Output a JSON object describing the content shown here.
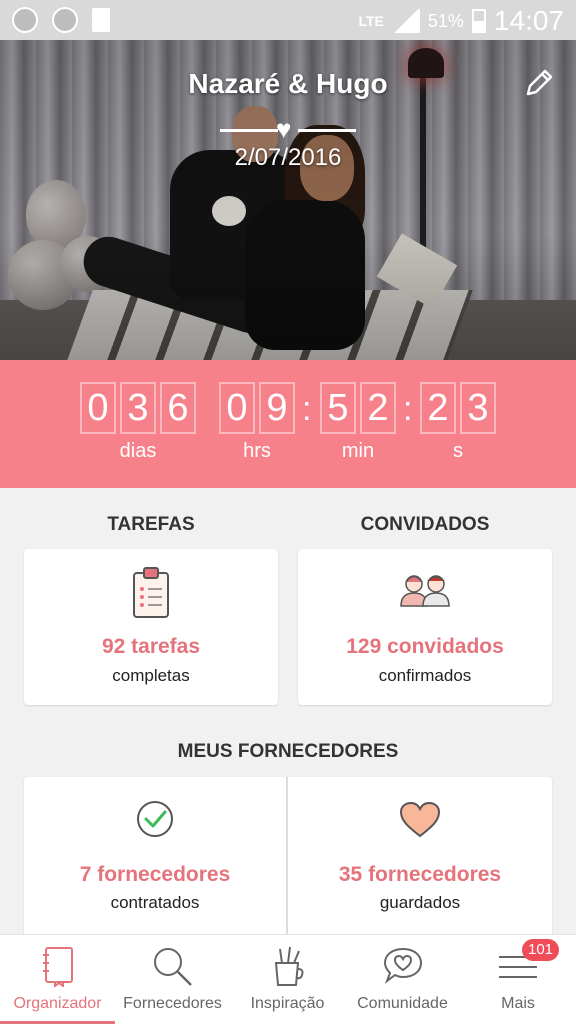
{
  "status_bar": {
    "network": "LTE",
    "battery": "51%",
    "time": "14:07"
  },
  "hero": {
    "couple_names": "Nazaré & Hugo",
    "date": "2/07/2016"
  },
  "countdown": {
    "days": [
      "0",
      "3",
      "6"
    ],
    "hours": [
      "0",
      "9"
    ],
    "minutes": [
      "5",
      "2"
    ],
    "seconds": [
      "2",
      "3"
    ],
    "labels": {
      "days": "dias",
      "hours": "hrs",
      "minutes": "min",
      "seconds": "s"
    },
    "separator": ":"
  },
  "tasks": {
    "title": "TAREFAS",
    "value": "92 tarefas",
    "sub": "completas"
  },
  "guests": {
    "title": "CONVIDADOS",
    "value": "129 convidados",
    "sub": "confirmados"
  },
  "vendors": {
    "title": "MEUS FORNECEDORES",
    "hired": {
      "value": "7 fornecedores",
      "sub": "contratados"
    },
    "saved": {
      "value": "35 fornecedores",
      "sub": "guardados"
    }
  },
  "nav": {
    "items": [
      {
        "label": "Organizador",
        "icon": "notebook-icon",
        "active": true
      },
      {
        "label": "Fornecedores",
        "icon": "search-icon"
      },
      {
        "label": "Inspiração",
        "icon": "pencil-cup-icon"
      },
      {
        "label": "Comunidade",
        "icon": "chat-heart-icon"
      },
      {
        "label": "Mais",
        "icon": "menu-icon",
        "badge": "101"
      }
    ]
  },
  "colors": {
    "accent": "#e5737c",
    "countdown_bg": "#f6818b",
    "badge": "#f04c58"
  }
}
